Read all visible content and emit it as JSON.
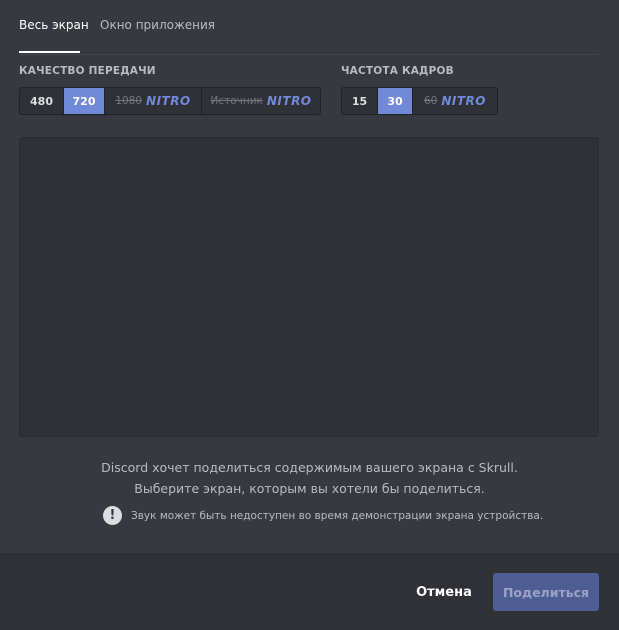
{
  "tabs": [
    {
      "label": "Весь экран",
      "active": true
    },
    {
      "label": "Окно приложения",
      "active": false
    }
  ],
  "quality": {
    "label": "КАЧЕСТВО ПЕРЕДАЧИ",
    "options": [
      {
        "label": "480",
        "state": "normal"
      },
      {
        "label": "720",
        "state": "selected"
      },
      {
        "label": "1080",
        "badge": "NITRO",
        "state": "locked"
      },
      {
        "label": "Источник",
        "badge": "NITRO",
        "state": "locked"
      }
    ]
  },
  "framerate": {
    "label": "ЧАСТОТА КАДРОВ",
    "options": [
      {
        "label": "15",
        "state": "normal"
      },
      {
        "label": "30",
        "state": "selected"
      },
      {
        "label": "60",
        "badge": "NITRO",
        "state": "locked"
      }
    ]
  },
  "message": {
    "line1": "Discord хочет поделиться содержимым вашего экрана с Skrull.",
    "line2": "Выберите экран, которым вы хотели бы поделиться."
  },
  "warning": {
    "icon": "exclamation-icon",
    "text": "Звук может быть недоступен во время демонстрации экрана устройства."
  },
  "footer": {
    "cancel_label": "Отмена",
    "share_label": "Поделиться"
  },
  "colors": {
    "accent": "#7289da",
    "background": "#36393f",
    "footer": "#2f3136",
    "share_disabled": "#4e5d94"
  }
}
